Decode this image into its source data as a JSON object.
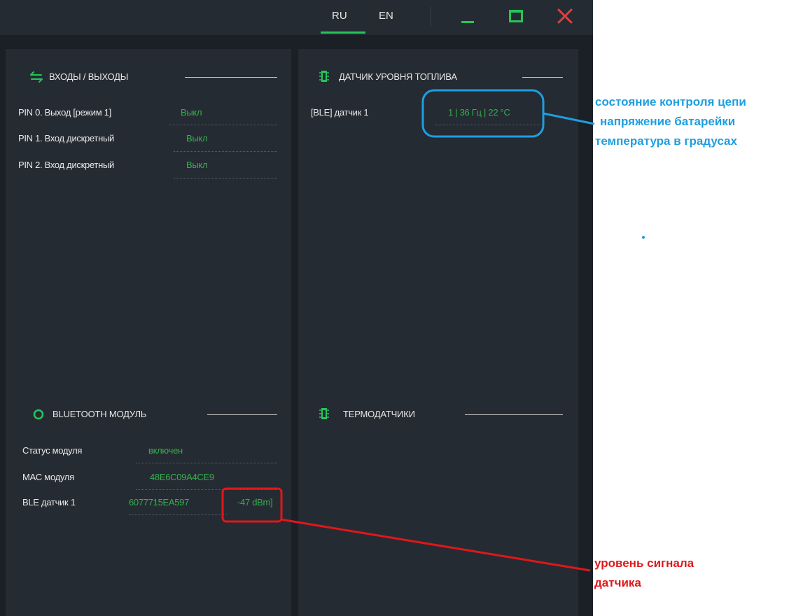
{
  "titlebar": {
    "lang_ru": "RU",
    "lang_en": "EN"
  },
  "io_section": {
    "title": "ВХОДЫ / ВЫХОДЫ",
    "rows": [
      {
        "label": "PIN 0. Выход [режим 1]",
        "value": "Выкл"
      },
      {
        "label": "PIN 1. Вход дискретный",
        "value": "Выкл"
      },
      {
        "label": "PIN 2. Вход дискретный",
        "value": "Выкл"
      }
    ]
  },
  "fuel_section": {
    "title": "ДАТЧИК УРОВНЯ ТОПЛИВА",
    "rows": [
      {
        "label": "[BLE] датчик 1",
        "value": "1 | 36 Гц | 22 °C"
      }
    ]
  },
  "bluetooth_section": {
    "title": "BLUETOOTH МОДУЛЬ",
    "rows": [
      {
        "label": "Статус модуля",
        "value": "включен"
      },
      {
        "label": "MAC модуля",
        "value": "48E6C09A4CE9"
      },
      {
        "label": "BLE датчик 1",
        "value": "6077715EA597",
        "signal": "-47 dBm]"
      }
    ]
  },
  "thermo_section": {
    "title": "ТЕРМОДАТЧИКИ"
  },
  "annotations": {
    "blue_lines": [
      "состояние контроля цепи",
      "напряжение батарейки",
      "температура в градусах"
    ],
    "red_lines": [
      "уровень сигнала",
      "датчика"
    ]
  },
  "colors": {
    "accent_green": "#27c45a",
    "value_green": "#34b04e",
    "close_red": "#e04040",
    "annotation_blue": "#1e9ee0",
    "annotation_red": "#e0171a"
  },
  "icons": [
    "swap-arrows-icon",
    "chip-icon",
    "bluetooth-ring-icon",
    "minimize-icon",
    "maximize-icon",
    "close-icon"
  ]
}
